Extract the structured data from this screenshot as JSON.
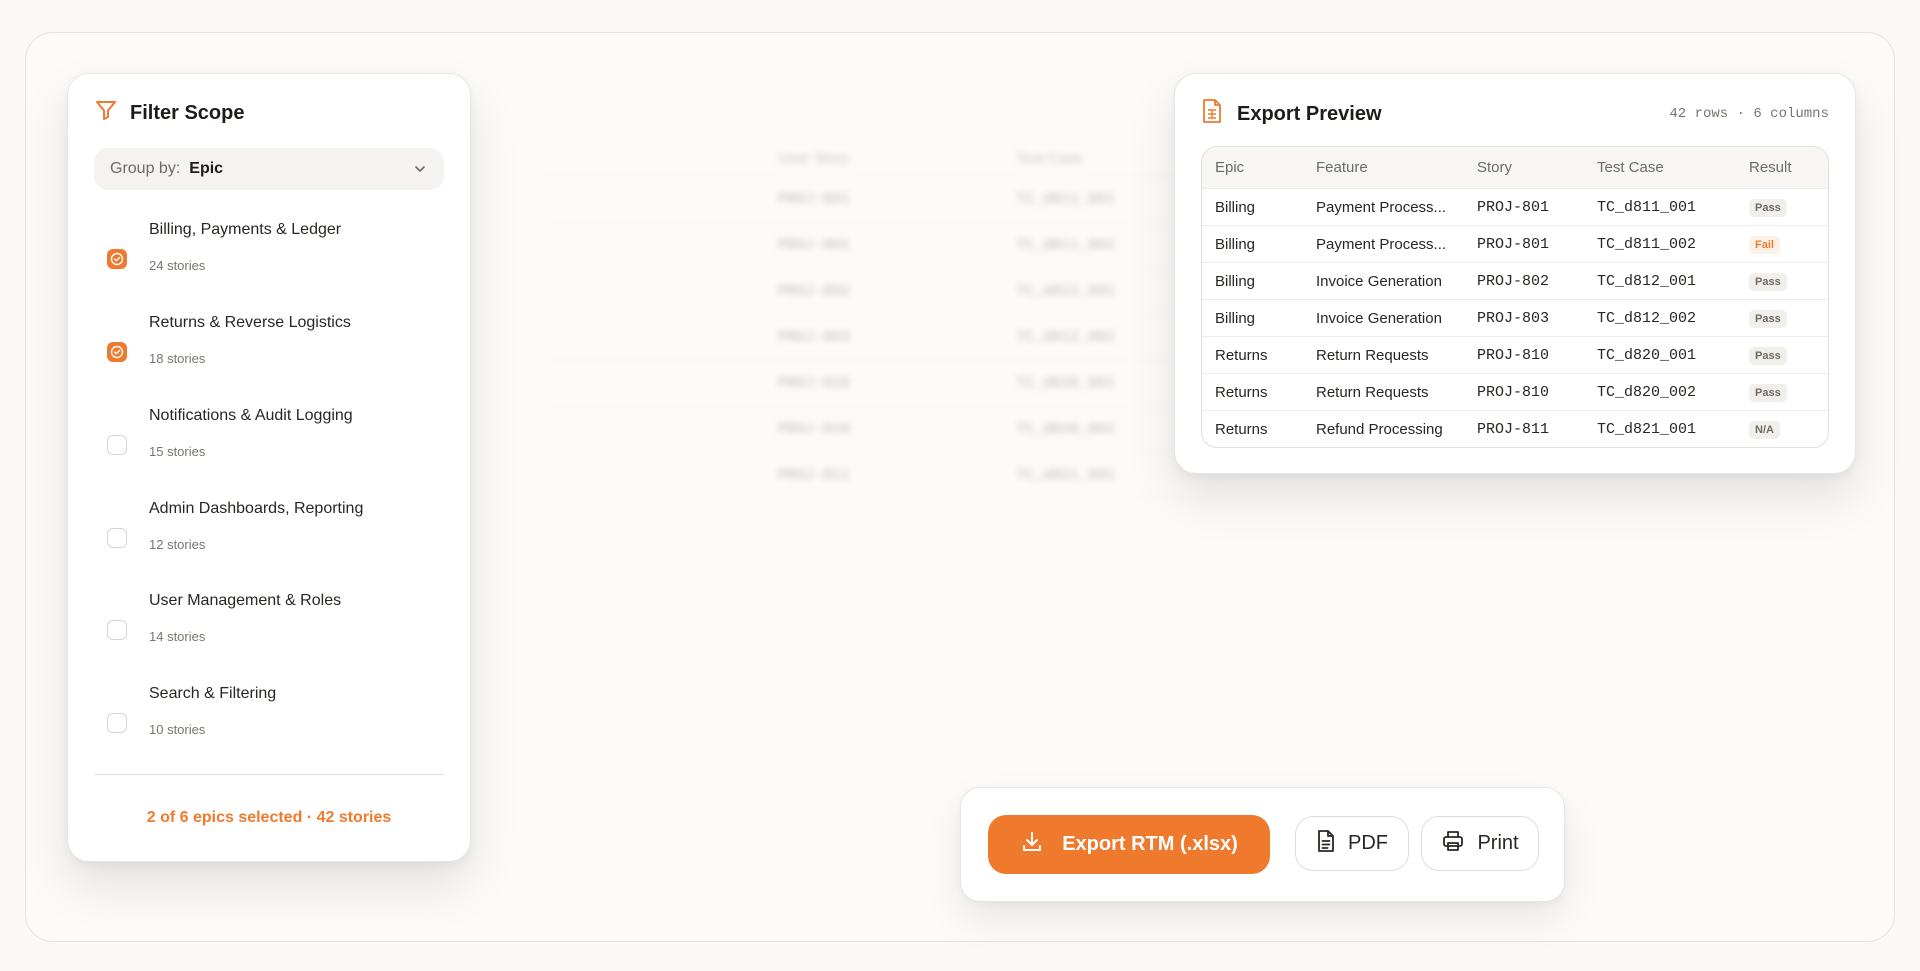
{
  "background_table": {
    "headers": [
      "User Story",
      "Test Case"
    ],
    "rows": [
      [
        "PROJ-801",
        "TC_d811_001"
      ],
      [
        "PROJ-801",
        "TC_d811_002"
      ],
      [
        "PROJ-802",
        "TC_d812_001"
      ],
      [
        "PROJ-803",
        "TC_d812_002"
      ],
      [
        "PROJ-810",
        "TC_d820_001"
      ],
      [
        "PROJ-810",
        "TC_d820_002"
      ],
      [
        "PROJ-811",
        "TC_d821_001"
      ]
    ]
  },
  "filter": {
    "title": "Filter Scope",
    "icon": "filter-icon",
    "group_by_label": "Group by:",
    "group_by_value": "Epic",
    "epics": [
      {
        "name": "Billing, Payments & Ledger",
        "count": "24 stories",
        "checked": true
      },
      {
        "name": "Returns & Reverse Logistics",
        "count": "18 stories",
        "checked": true
      },
      {
        "name": "Notifications & Audit Logging",
        "count": "15 stories",
        "checked": false
      },
      {
        "name": "Admin Dashboards, Reporting",
        "count": "12 stories",
        "checked": false
      },
      {
        "name": "User Management & Roles",
        "count": "14 stories",
        "checked": false
      },
      {
        "name": "Search & Filtering",
        "count": "10 stories",
        "checked": false
      }
    ],
    "summary": "2 of 6 epics selected · 42 stories"
  },
  "preview": {
    "title": "Export Preview",
    "icon": "spreadsheet-file-icon",
    "meta": "42 rows · 6 columns",
    "columns": [
      "Epic",
      "Feature",
      "Story",
      "Test Case",
      "Result"
    ],
    "rows": [
      [
        "Billing",
        "Payment Process...",
        "PROJ-801",
        "TC_d811_001",
        "Pass"
      ],
      [
        "Billing",
        "Payment Process...",
        "PROJ-801",
        "TC_d811_002",
        "Fail"
      ],
      [
        "Billing",
        "Invoice Generation",
        "PROJ-802",
        "TC_d812_001",
        "Pass"
      ],
      [
        "Billing",
        "Invoice Generation",
        "PROJ-803",
        "TC_d812_002",
        "Pass"
      ],
      [
        "Returns",
        "Return Requests",
        "PROJ-810",
        "TC_d820_001",
        "Pass"
      ],
      [
        "Returns",
        "Return Requests",
        "PROJ-810",
        "TC_d820_002",
        "Pass"
      ],
      [
        "Returns",
        "Refund Processing",
        "PROJ-811",
        "TC_d821_001",
        "N/A"
      ]
    ]
  },
  "actions": {
    "export_label": "Export RTM (.xlsx)",
    "pdf_label": "PDF",
    "print_label": "Print"
  },
  "colors": {
    "accent": "#ef7a2e",
    "fail_badge_bg": "#fdf0e6"
  }
}
